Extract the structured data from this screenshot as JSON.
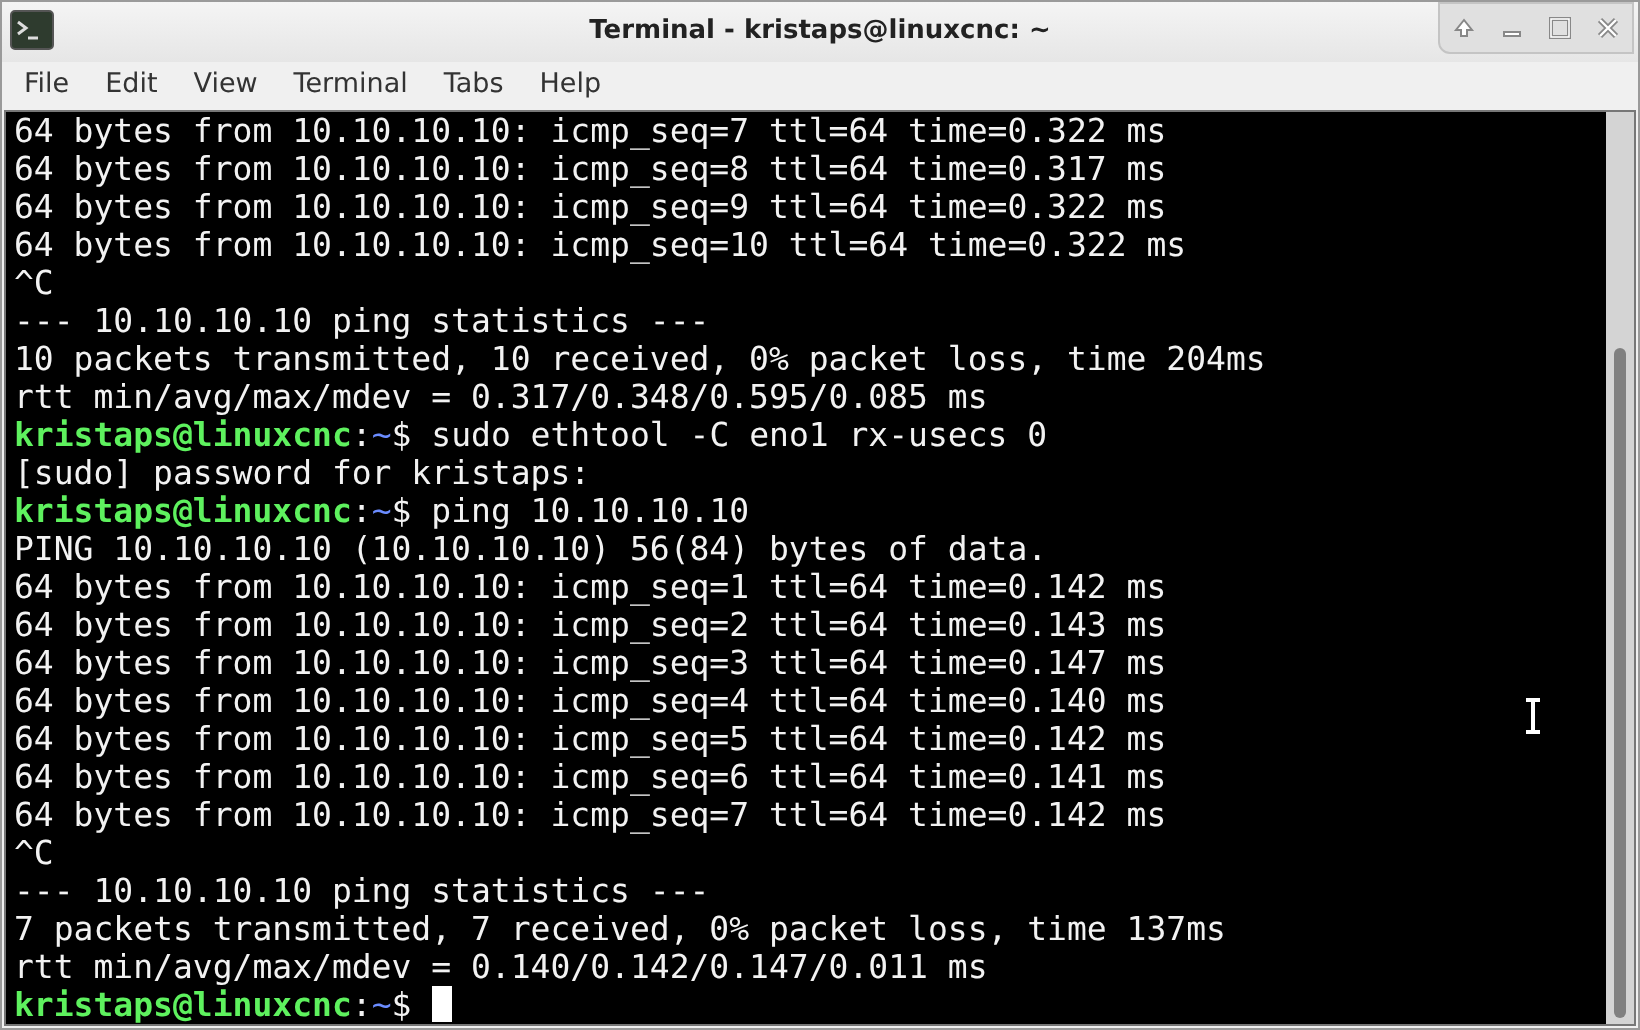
{
  "window": {
    "title": "Terminal - kristaps@linuxcnc: ~"
  },
  "menu": [
    "File",
    "Edit",
    "View",
    "Terminal",
    "Tabs",
    "Help"
  ],
  "lines": [
    {
      "kind": "output",
      "text": "64 bytes from 10.10.10.10: icmp_seq=7 ttl=64 time=0.322 ms"
    },
    {
      "kind": "output",
      "text": "64 bytes from 10.10.10.10: icmp_seq=8 ttl=64 time=0.317 ms"
    },
    {
      "kind": "output",
      "text": "64 bytes from 10.10.10.10: icmp_seq=9 ttl=64 time=0.322 ms"
    },
    {
      "kind": "output",
      "text": "64 bytes from 10.10.10.10: icmp_seq=10 ttl=64 time=0.322 ms"
    },
    {
      "kind": "output",
      "text": "^C"
    },
    {
      "kind": "output",
      "text": "--- 10.10.10.10 ping statistics ---"
    },
    {
      "kind": "output",
      "text": "10 packets transmitted, 10 received, 0% packet loss, time 204ms"
    },
    {
      "kind": "output",
      "text": "rtt min/avg/max/mdev = 0.317/0.348/0.595/0.085 ms"
    },
    {
      "kind": "prompt",
      "user": "kristaps@linuxcnc",
      "separator": ":",
      "path": "~",
      "symbol": "$",
      "command": "sudo ethtool -C eno1 rx-usecs 0"
    },
    {
      "kind": "output",
      "text": "[sudo] password for kristaps:"
    },
    {
      "kind": "prompt",
      "user": "kristaps@linuxcnc",
      "separator": ":",
      "path": "~",
      "symbol": "$",
      "command": "ping 10.10.10.10"
    },
    {
      "kind": "output",
      "text": "PING 10.10.10.10 (10.10.10.10) 56(84) bytes of data."
    },
    {
      "kind": "output",
      "text": "64 bytes from 10.10.10.10: icmp_seq=1 ttl=64 time=0.142 ms"
    },
    {
      "kind": "output",
      "text": "64 bytes from 10.10.10.10: icmp_seq=2 ttl=64 time=0.143 ms"
    },
    {
      "kind": "output",
      "text": "64 bytes from 10.10.10.10: icmp_seq=3 ttl=64 time=0.147 ms"
    },
    {
      "kind": "output",
      "text": "64 bytes from 10.10.10.10: icmp_seq=4 ttl=64 time=0.140 ms"
    },
    {
      "kind": "output",
      "text": "64 bytes from 10.10.10.10: icmp_seq=5 ttl=64 time=0.142 ms"
    },
    {
      "kind": "output",
      "text": "64 bytes from 10.10.10.10: icmp_seq=6 ttl=64 time=0.141 ms"
    },
    {
      "kind": "output",
      "text": "64 bytes from 10.10.10.10: icmp_seq=7 ttl=64 time=0.142 ms"
    },
    {
      "kind": "output",
      "text": "^C"
    },
    {
      "kind": "output",
      "text": "--- 10.10.10.10 ping statistics ---"
    },
    {
      "kind": "output",
      "text": "7 packets transmitted, 7 received, 0% packet loss, time 137ms"
    },
    {
      "kind": "output",
      "text": "rtt min/avg/max/mdev = 0.140/0.142/0.147/0.011 ms"
    },
    {
      "kind": "prompt",
      "user": "kristaps@linuxcnc",
      "separator": ":",
      "path": "~",
      "symbol": "$",
      "cursor": true
    }
  ]
}
